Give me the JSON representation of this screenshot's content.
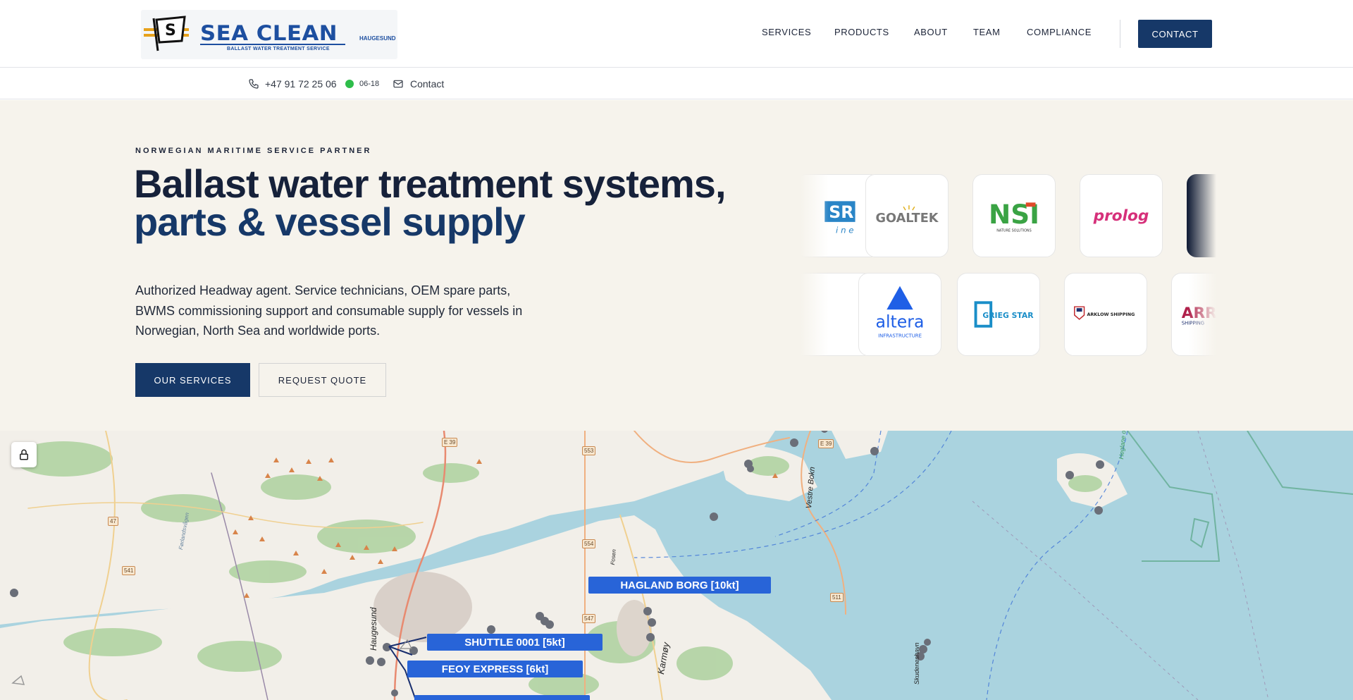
{
  "header": {
    "logo": {
      "brand": "SEA CLEAN",
      "tagline": "BALLAST WATER TREATMENT SERVICE",
      "city": "HAUGESUND"
    },
    "nav": [
      "SERVICES",
      "PRODUCTS",
      "ABOUT",
      "TEAM",
      "COMPLIANCE"
    ],
    "contact_button": "CONTACT"
  },
  "contact_strip": {
    "phone": "+47 91 72 25 06",
    "hours": "06-18",
    "contact_link": "Contact",
    "status_color": "#2ebd4a"
  },
  "hero": {
    "eyebrow": "NORWEGIAN MARITIME SERVICE PARTNER",
    "title_line1": "Ballast water treatment systems,",
    "title_line2": "parts & vessel supply",
    "lead": "Authorized Headway agent. Service technicians, OEM spare parts, BWMS commissioning support and consumable supply for vessels in Norwegian, North Sea and worldwide ports.",
    "primary_button": "OUR SERVICES",
    "secondary_button": "REQUEST QUOTE"
  },
  "partner_logos": {
    "row1": [
      {
        "name": "sr-marine",
        "text": "SR"
      },
      {
        "name": "goaltek",
        "text": "GOALTEK"
      },
      {
        "name": "nsi",
        "text": "NSI",
        "caption": "NATURE SOLUTIONS"
      },
      {
        "name": "prolog",
        "text": "prolog"
      },
      {
        "name": "dark-logo",
        "text": ""
      }
    ],
    "row2": [
      {
        "name": "blank",
        "text": ""
      },
      {
        "name": "altera",
        "text": "altera",
        "caption": "INFRASTRUCTURE"
      },
      {
        "name": "grieg-star",
        "text": "GRIEG STAR"
      },
      {
        "name": "arklow",
        "text": "ARKLOW SHIPPING"
      },
      {
        "name": "arr",
        "text": "ARR",
        "caption": "SHIPPING"
      }
    ]
  },
  "map": {
    "vessels": [
      {
        "label": "HAGLAND BORG [10kt]"
      },
      {
        "label": "SHUTTLE 0001 [5kt]"
      },
      {
        "label": "FEOY EXPRESS [6kt]"
      }
    ],
    "place_names": [
      "Haugesund",
      "Karmøy",
      "Vestre Bokn",
      "Skudeneshavn",
      "Førlandsvågen",
      "Fosen",
      "Heglane og Eime dyrelivsfreden"
    ],
    "roads": [
      "E 39",
      "553",
      "E 39",
      "47",
      "541",
      "554",
      "547",
      "511"
    ],
    "colors": {
      "water": "#aad3df",
      "land": "#f2efe9",
      "forest": "#add19e",
      "vessel_label": "#2864d8"
    }
  }
}
